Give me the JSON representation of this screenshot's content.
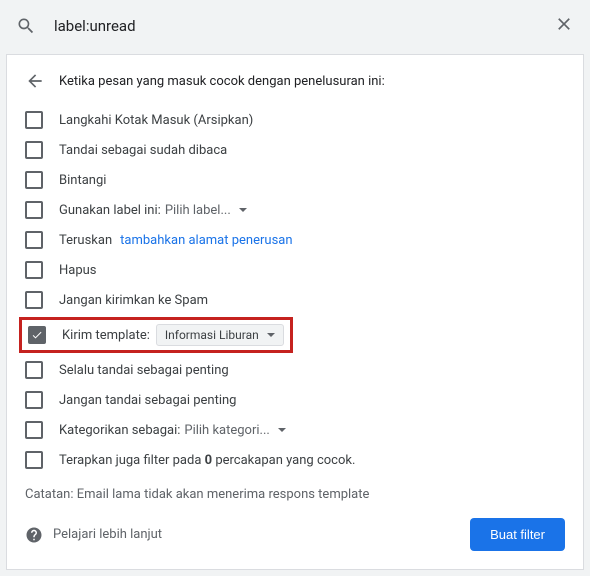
{
  "search": {
    "query": "label:unread"
  },
  "header": "Ketika pesan yang masuk cocok dengan penelusuran ini:",
  "options": {
    "archive": "Langkahi Kotak Masuk (Arsipkan)",
    "markRead": "Tandai sebagai sudah dibaca",
    "star": "Bintangi",
    "applyLabel": "Gunakan label ini:",
    "applyLabelDropdown": "Pilih label...",
    "forward": "Teruskan",
    "forwardLink": "tambahkan alamat penerusan",
    "delete": "Hapus",
    "neverSpam": "Jangan kirimkan ke Spam",
    "sendTemplate": "Kirim template:",
    "sendTemplateValue": "Informasi Liburan",
    "alwaysImportant": "Selalu tandai sebagai penting",
    "neverImportant": "Jangan tandai sebagai penting",
    "categorize": "Kategorikan sebagai:",
    "categorizeDropdown": "Pilih kategori...",
    "applyExistingPrefix": "Terapkan juga filter pada ",
    "applyExistingCount": "0",
    "applyExistingSuffix": " percakapan yang cocok."
  },
  "note": "Catatan: Email lama tidak akan menerima respons template",
  "learnMore": "Pelajari lebih lanjut",
  "createButton": "Buat filter"
}
